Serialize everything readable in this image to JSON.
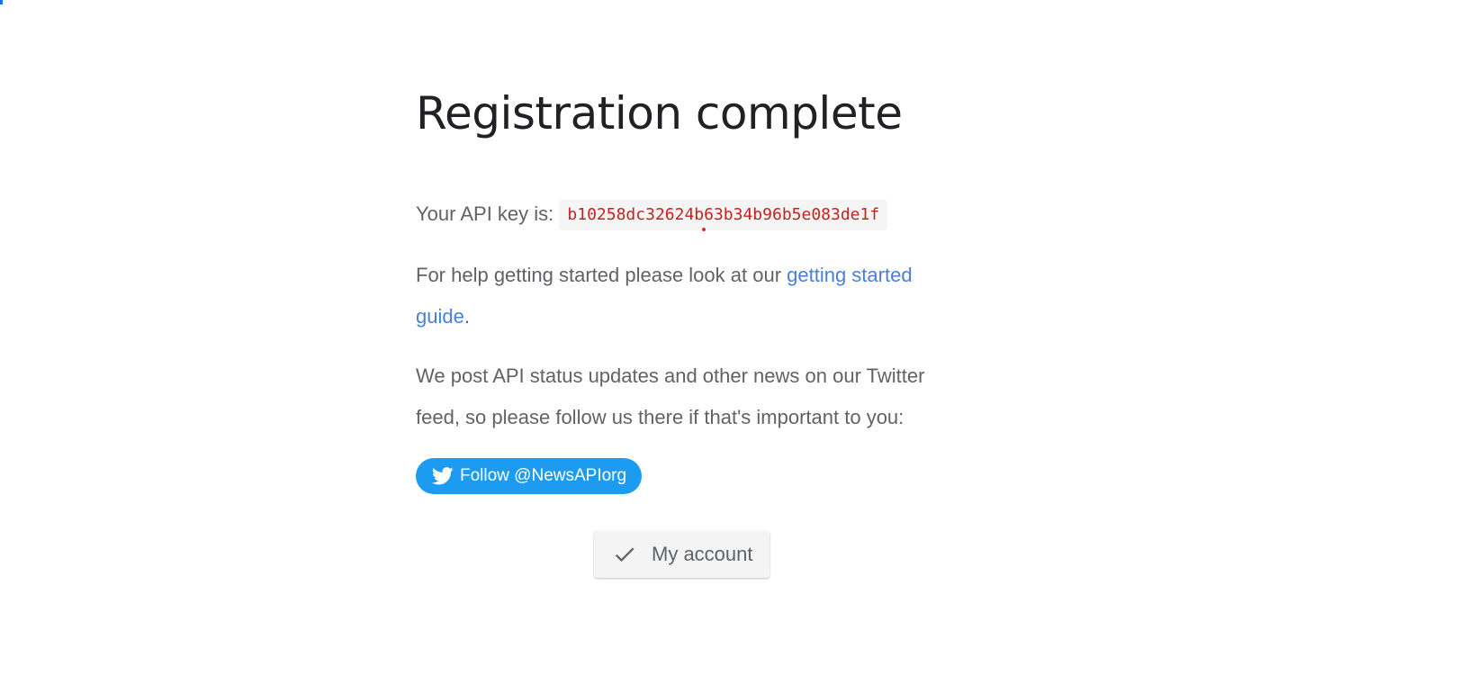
{
  "page": {
    "title": "Registration complete"
  },
  "api_key": {
    "label": "Your API key is:",
    "value": "b10258dc32624b63b34b96b5e083de1f"
  },
  "help": {
    "text_before": "For help getting started please look at our ",
    "link_text": "getting started guide",
    "text_after": "."
  },
  "news": {
    "text": "We post API status updates and other news on our Twitter feed, so please follow us there if that's important to you:"
  },
  "twitter_button": {
    "label": "Follow @NewsAPIorg",
    "icon": "twitter-bird-icon",
    "color": "#1d9bf0"
  },
  "account_button": {
    "label": "My account",
    "icon": "check-icon"
  },
  "colors": {
    "api_key_text": "#c5221f",
    "link": "#4a7fd8",
    "body_text": "#5f6368"
  }
}
